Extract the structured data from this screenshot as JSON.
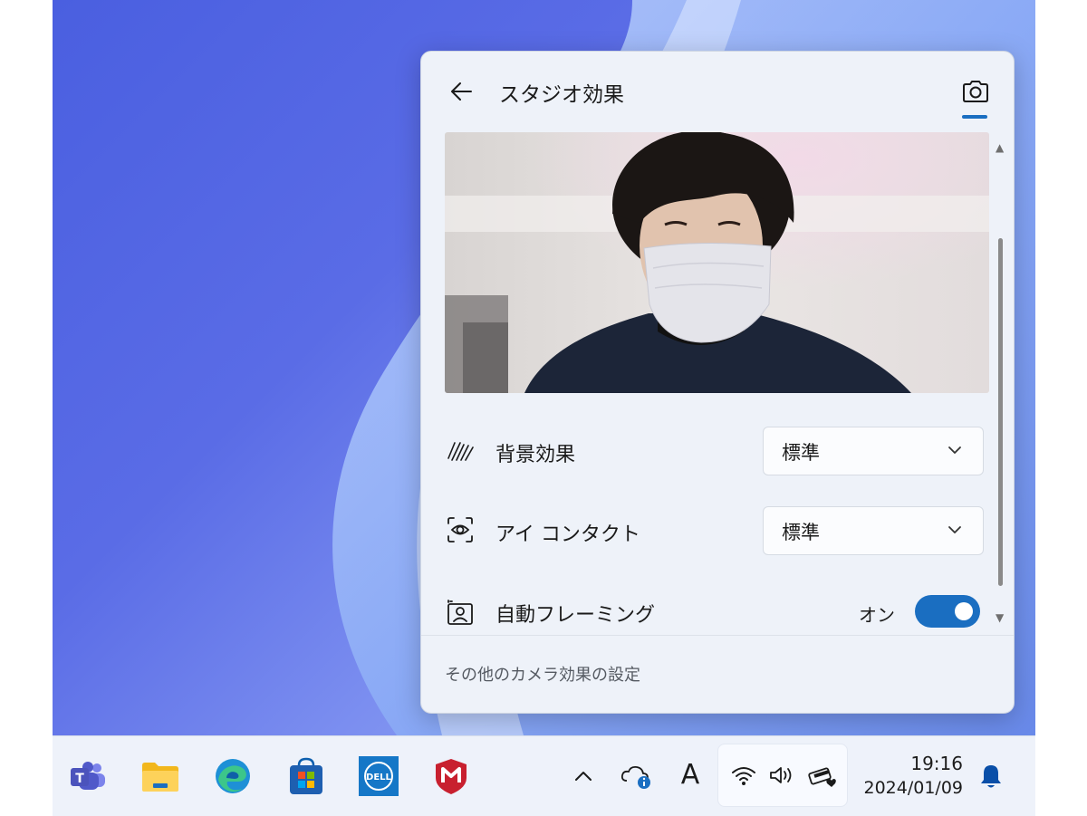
{
  "panel": {
    "title": "スタジオ効果",
    "back_icon": "back-arrow-icon",
    "camera_icon": "camera-icon",
    "settings": [
      {
        "icon": "background-blur-icon",
        "label": "背景効果",
        "value": "標準"
      },
      {
        "icon": "eye-contact-icon",
        "label": "アイ コンタクト",
        "value": "標準"
      }
    ],
    "auto_framing": {
      "icon": "auto-framing-icon",
      "label": "自動フレーミング",
      "state_label": "オン",
      "on": true
    },
    "footer_link": "その他のカメラ効果の設定",
    "accent_color": "#1a6ec1"
  },
  "taskbar": {
    "apps": [
      "teams-icon",
      "file-explorer-icon",
      "edge-icon",
      "store-icon",
      "dell-icon",
      "mcafee-icon"
    ],
    "tray": {
      "chevron_icon": "chevron-up-icon",
      "cloud_icon": "onedrive-info-icon",
      "ime_label": "A",
      "wifi_icon": "wifi-icon",
      "volume_icon": "volume-icon",
      "battery_icon": "battery-charging-icon"
    },
    "clock": {
      "time": "19:16",
      "date": "2024/01/09"
    },
    "notification_icon": "notification-bell-icon"
  }
}
